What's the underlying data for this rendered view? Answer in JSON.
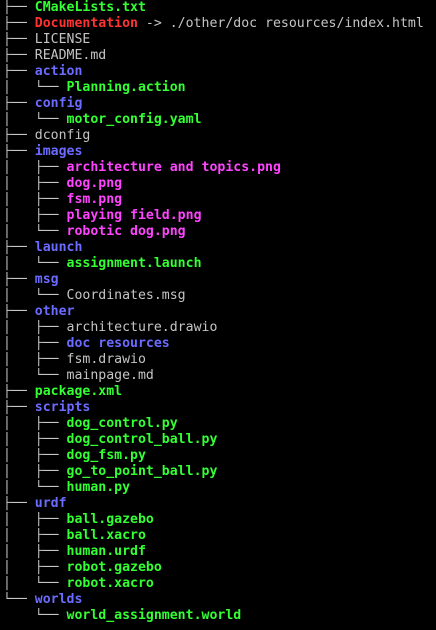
{
  "colors": {
    "file": "#c5c5c5",
    "directory": "#6b6bff",
    "executable": "#33ff33",
    "image": "#ff44ff",
    "symlink": "#ff3333",
    "background": "#000000"
  },
  "tree": [
    {
      "branch": "├── ",
      "name": "CMakeLists.txt",
      "type": "exec"
    },
    {
      "branch": "├── ",
      "name": "Documentation",
      "type": "link",
      "target": " -> ./other/doc resources/index.html"
    },
    {
      "branch": "├── ",
      "name": "LICENSE",
      "type": "file"
    },
    {
      "branch": "├── ",
      "name": "README.md",
      "type": "file"
    },
    {
      "branch": "├── ",
      "name": "action",
      "type": "dir"
    },
    {
      "branch": "│   └── ",
      "name": "Planning.action",
      "type": "exec"
    },
    {
      "branch": "├── ",
      "name": "config",
      "type": "dir"
    },
    {
      "branch": "│   └── ",
      "name": "motor_config.yaml",
      "type": "exec"
    },
    {
      "branch": "├── ",
      "name": "dconfig",
      "type": "file"
    },
    {
      "branch": "├── ",
      "name": "images",
      "type": "dir"
    },
    {
      "branch": "│   ├── ",
      "name": "architecture and topics.png",
      "type": "media"
    },
    {
      "branch": "│   ├── ",
      "name": "dog.png",
      "type": "media"
    },
    {
      "branch": "│   ├── ",
      "name": "fsm.png",
      "type": "media"
    },
    {
      "branch": "│   ├── ",
      "name": "playing field.png",
      "type": "media"
    },
    {
      "branch": "│   └── ",
      "name": "robotic dog.png",
      "type": "media"
    },
    {
      "branch": "├── ",
      "name": "launch",
      "type": "dir"
    },
    {
      "branch": "│   └── ",
      "name": "assignment.launch",
      "type": "exec"
    },
    {
      "branch": "├── ",
      "name": "msg",
      "type": "dir"
    },
    {
      "branch": "│   └── ",
      "name": "Coordinates.msg",
      "type": "file"
    },
    {
      "branch": "├── ",
      "name": "other",
      "type": "dir"
    },
    {
      "branch": "│   ├── ",
      "name": "architecture.drawio",
      "type": "file"
    },
    {
      "branch": "│   ├── ",
      "name": "doc resources",
      "type": "dir"
    },
    {
      "branch": "│   ├── ",
      "name": "fsm.drawio",
      "type": "file"
    },
    {
      "branch": "│   └── ",
      "name": "mainpage.md",
      "type": "file"
    },
    {
      "branch": "├── ",
      "name": "package.xml",
      "type": "exec"
    },
    {
      "branch": "├── ",
      "name": "scripts",
      "type": "dir"
    },
    {
      "branch": "│   ├── ",
      "name": "dog_control.py",
      "type": "exec"
    },
    {
      "branch": "│   ├── ",
      "name": "dog_control_ball.py",
      "type": "exec"
    },
    {
      "branch": "│   ├── ",
      "name": "dog_fsm.py",
      "type": "exec"
    },
    {
      "branch": "│   ├── ",
      "name": "go_to_point_ball.py",
      "type": "exec"
    },
    {
      "branch": "│   └── ",
      "name": "human.py",
      "type": "exec"
    },
    {
      "branch": "├── ",
      "name": "urdf",
      "type": "dir"
    },
    {
      "branch": "│   ├── ",
      "name": "ball.gazebo",
      "type": "exec"
    },
    {
      "branch": "│   ├── ",
      "name": "ball.xacro",
      "type": "exec"
    },
    {
      "branch": "│   ├── ",
      "name": "human.urdf",
      "type": "exec"
    },
    {
      "branch": "│   ├── ",
      "name": "robot.gazebo",
      "type": "exec"
    },
    {
      "branch": "│   └── ",
      "name": "robot.xacro",
      "type": "exec"
    },
    {
      "branch": "└── ",
      "name": "worlds",
      "type": "dir"
    },
    {
      "branch": "    └── ",
      "name": "world_assignment.world",
      "type": "exec"
    }
  ]
}
